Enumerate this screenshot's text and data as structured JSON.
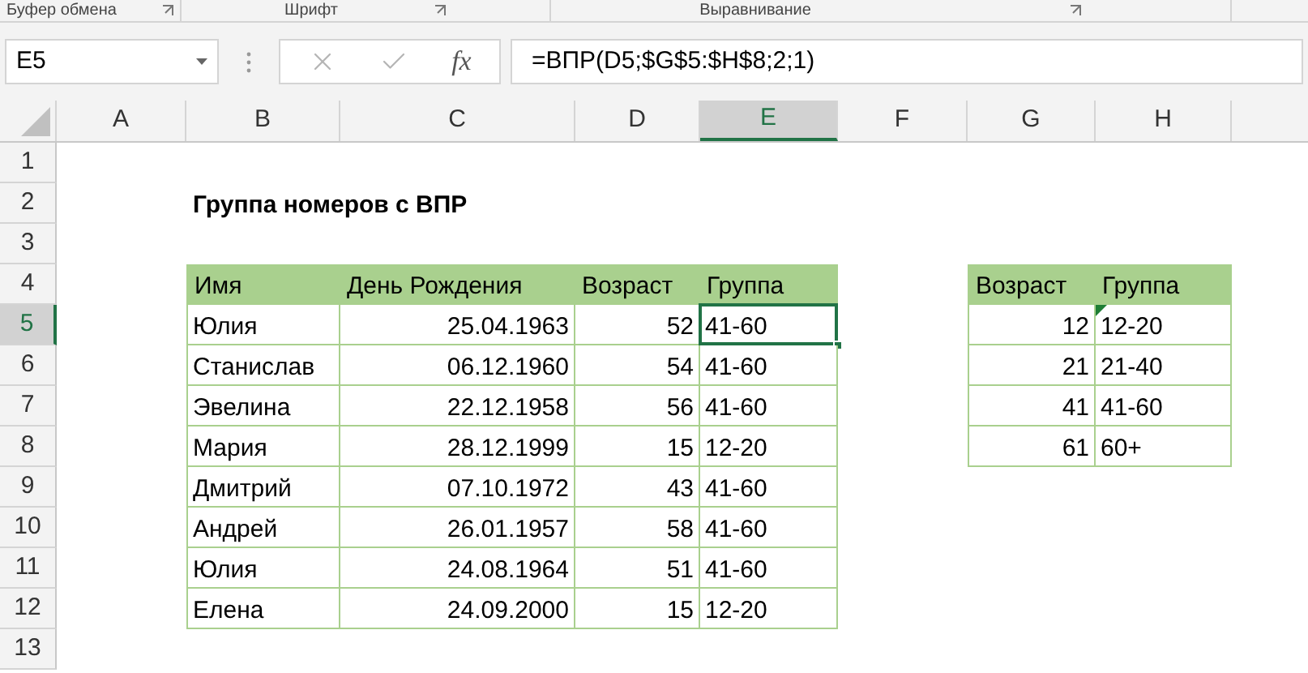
{
  "ribbon_groups": [
    "Буфер обмена",
    "Шрифт",
    "Выравнивание"
  ],
  "name_box": "E5",
  "function_button": "fx",
  "formula": "=ВПР(D5;$G$5:$H$8;2;1)",
  "columns": [
    {
      "label": "A",
      "selected": false
    },
    {
      "label": "B",
      "selected": false
    },
    {
      "label": "C",
      "selected": false
    },
    {
      "label": "D",
      "selected": false
    },
    {
      "label": "E",
      "selected": true
    },
    {
      "label": "F",
      "selected": false
    },
    {
      "label": "G",
      "selected": false
    },
    {
      "label": "H",
      "selected": false
    }
  ],
  "rows": [
    {
      "label": "1",
      "selected": false
    },
    {
      "label": "2",
      "selected": false
    },
    {
      "label": "3",
      "selected": false
    },
    {
      "label": "4",
      "selected": false
    },
    {
      "label": "5",
      "selected": true
    },
    {
      "label": "6",
      "selected": false
    },
    {
      "label": "7",
      "selected": false
    },
    {
      "label": "8",
      "selected": false
    },
    {
      "label": "9",
      "selected": false
    },
    {
      "label": "10",
      "selected": false
    },
    {
      "label": "11",
      "selected": false
    },
    {
      "label": "12",
      "selected": false
    },
    {
      "label": "13",
      "selected": false
    }
  ],
  "title": "Группа номеров с ВПР",
  "main_table": {
    "columns": [
      "Имя",
      "День Рождения",
      "Возраст",
      "Группа"
    ],
    "rows": [
      {
        "name": "Юлия",
        "birthday": "25.04.1963",
        "age": "52",
        "group": "41-60",
        "selected": true
      },
      {
        "name": "Станислав",
        "birthday": "06.12.1960",
        "age": "54",
        "group": "41-60",
        "selected": false
      },
      {
        "name": "Эвелина",
        "birthday": "22.12.1958",
        "age": "56",
        "group": "41-60",
        "selected": false
      },
      {
        "name": "Мария",
        "birthday": "28.12.1999",
        "age": "15",
        "group": "12-20",
        "selected": false
      },
      {
        "name": "Дмитрий",
        "birthday": "07.10.1972",
        "age": "43",
        "group": "41-60",
        "selected": false
      },
      {
        "name": "Андрей",
        "birthday": "26.01.1957",
        "age": "58",
        "group": "41-60",
        "selected": false
      },
      {
        "name": "Юлия",
        "birthday": "24.08.1964",
        "age": "51",
        "group": "41-60",
        "selected": false
      },
      {
        "name": "Елена",
        "birthday": "24.09.2000",
        "age": "15",
        "group": "12-20",
        "selected": false
      }
    ]
  },
  "lookup_table": {
    "columns": [
      "Возраст",
      "Группа"
    ],
    "rows": [
      {
        "age": "12",
        "group": "12-20",
        "flagged": true
      },
      {
        "age": "21",
        "group": "21-40",
        "flagged": false
      },
      {
        "age": "41",
        "group": "41-60",
        "flagged": false
      },
      {
        "age": "61",
        "group": "60+",
        "flagged": false
      }
    ]
  }
}
